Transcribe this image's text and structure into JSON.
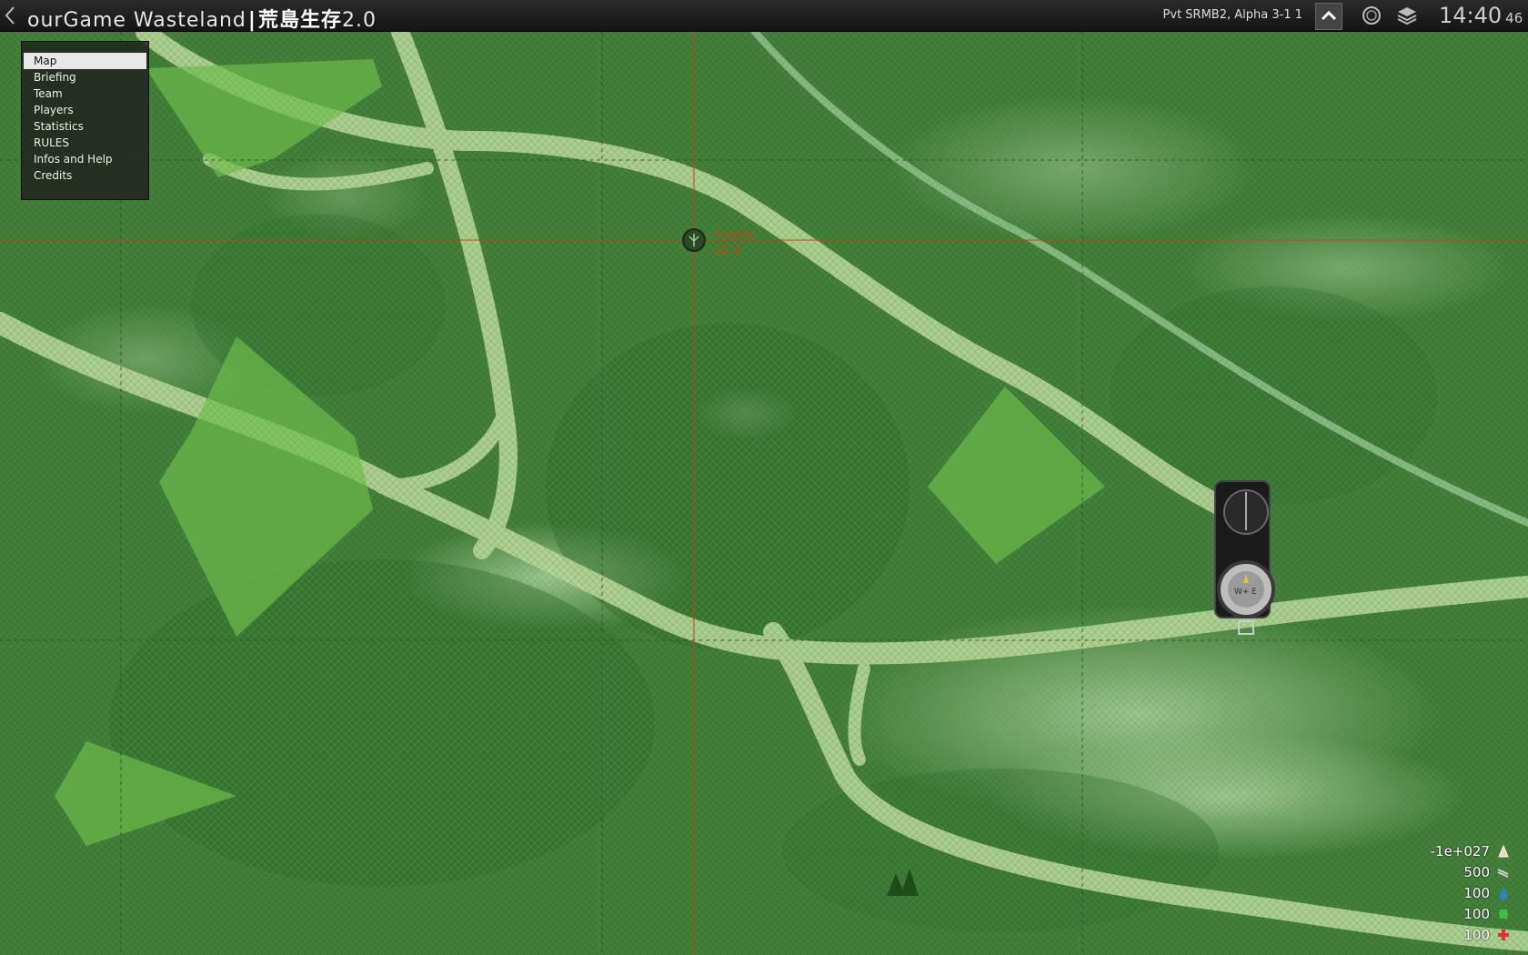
{
  "topbar": {
    "back_icon": "chevron-left-icon",
    "title_left": "ourGame  Wasteland",
    "title_separator": "|",
    "title_cn": "荒島生存",
    "title_version": "2.0",
    "player": "Pvt SRMB2, Alpha 3-1 1",
    "clock_hm": "14:40",
    "clock_sec": "46"
  },
  "menu": {
    "items": [
      "Map",
      "Briefing",
      "Team",
      "Players",
      "Statistics",
      "RULES",
      "Infos and Help",
      "Credits"
    ],
    "active": "Map"
  },
  "marker": {
    "grid": "035056",
    "distance": "22 m"
  },
  "stats": [
    {
      "value": "-1e+027",
      "icon": "money-icon",
      "color": "#e8d9b0"
    },
    {
      "value": "500",
      "icon": "ammo-icon",
      "color": "#cfcfcf"
    },
    {
      "value": "100",
      "icon": "water-icon",
      "color": "#2f7fe0"
    },
    {
      "value": "100",
      "icon": "food-icon",
      "color": "#3fbf3f"
    },
    {
      "value": "100",
      "icon": "health-icon",
      "color": "#e03030"
    }
  ],
  "colors": {
    "grid_major": "#b84a12",
    "road": "#b8d69a",
    "forest": "#3e7a36",
    "zone": "#6fbf4a"
  }
}
